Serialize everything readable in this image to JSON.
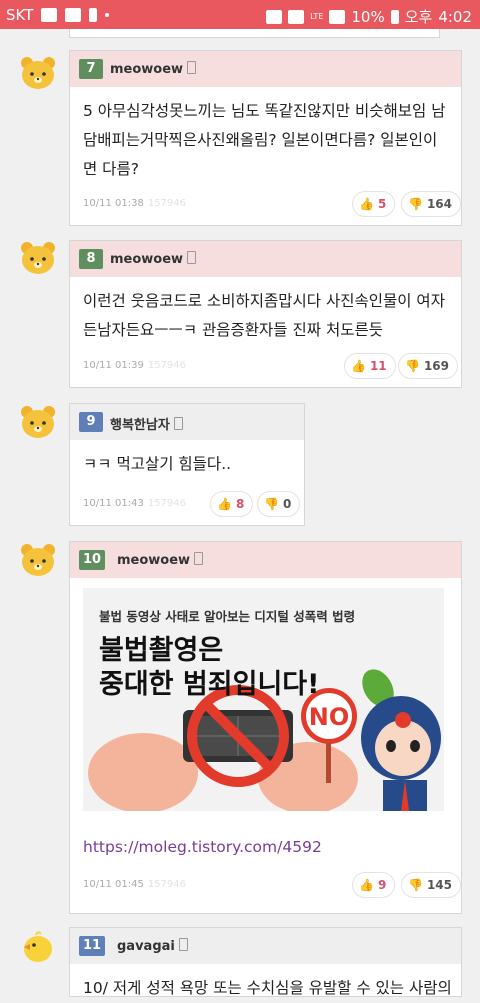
{
  "status_bar": {
    "carrier": "SKT",
    "battery": "10%",
    "time_prefix": "오후",
    "time": "4:02",
    "lte": "LTE"
  },
  "comments": [
    {
      "number": "7",
      "username": "meowoew",
      "text": "5 아무심각성못느끼는 님도 똑같진않지만 비슷해보임 남 담배피는거막찍은사진왜올림? 일본이면다름? 일본인이면 다름?",
      "date": "10/11 01:38",
      "id": "157946",
      "likes": "5",
      "dislikes": "164",
      "avatar": "bear-avatar-icon"
    },
    {
      "number": "8",
      "username": "meowoew",
      "text": "이런건 웃음코드로 소비하지좀맙시다 사진속인물이 여자든남자든요ㅡㅡㅋ 관음증환자들 진짜 처도른듯",
      "date": "10/11 01:39",
      "id": "157946",
      "likes": "11",
      "dislikes": "169",
      "avatar": "bear-avatar-icon"
    },
    {
      "number": "9",
      "username": "행복한남자",
      "text": "ㅋㅋ 먹고살기 힘들다..",
      "date": "10/11 01:43",
      "id": "157946",
      "likes": "8",
      "dislikes": "0",
      "avatar": "bear-avatar-icon"
    },
    {
      "number": "10",
      "username": "meowoew",
      "image": {
        "subtitle": "불법 동영상 사태로 알아보는 디지털 성폭력 법령",
        "title_line1": "불법촬영은",
        "title_line2": "중대한 범죄입니다!",
        "sign": "NO"
      },
      "link": "https://moleg.tistory.com/4592",
      "date": "10/11 01:45",
      "id": "157946",
      "likes": "9",
      "dislikes": "145",
      "avatar": "bear-avatar-icon"
    },
    {
      "number": "11",
      "username": "gavagai",
      "text": "10/ 저게 성적 욕망 또는 수치심을 유발할 수 있는 사람의",
      "avatar": "chick-avatar-icon"
    }
  ],
  "colors": {
    "status_bar": "#e8585e",
    "header_pink": "#f6dede",
    "num_green": "#5f8f5f",
    "num_blue": "#5e7fb7",
    "like": "#d9506a",
    "link": "#7a3c98"
  }
}
